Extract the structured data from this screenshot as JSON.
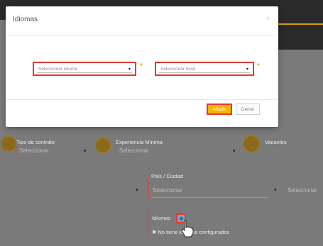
{
  "modal": {
    "title": "Idiomas",
    "close_glyph": "×",
    "language_select": {
      "placeholder": "Seleccionar idioma",
      "arrow": "▾"
    },
    "level_select": {
      "placeholder": "Seleccionar nivel",
      "arrow": "▾"
    },
    "required_mark": "*",
    "add_button": "Añadir",
    "close_button": "Cerrar"
  },
  "form": {
    "contract_type": {
      "label": "Tipo de contrato",
      "value": "Seleccionar"
    },
    "experience": {
      "label": "Experiencia Mínima",
      "value": "Seleccionar"
    },
    "vacancies": {
      "label": "Vacantes"
    },
    "country_city": {
      "label": "País / Ciudad",
      "value": "Seleccionar",
      "value2": "Seleccionar"
    },
    "languages": {
      "label": "Idiomas",
      "empty_message": "✖ No tiene idiomas configurados"
    }
  },
  "icons": {
    "gear": "gear-icon",
    "close": "close-icon",
    "arrow": "chevron-down-icon"
  },
  "colors": {
    "accent": "#f6b300",
    "highlight": "#e53935"
  }
}
